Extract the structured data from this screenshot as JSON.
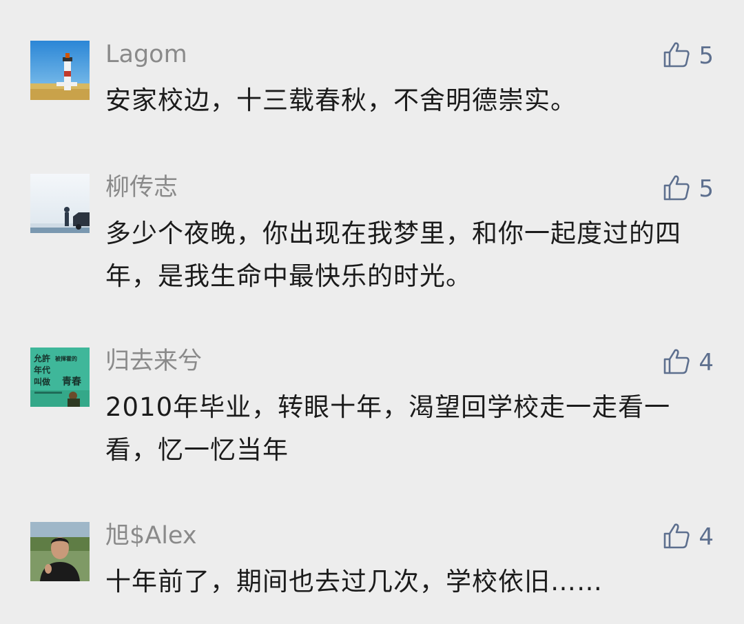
{
  "comments": [
    {
      "username": "Lagom",
      "like_count": "5",
      "text": "安家校边，十三载春秋，不舍明德崇实。",
      "avatar_subject": "lighthouse"
    },
    {
      "username": "柳传志",
      "like_count": "5",
      "text": "多少个夜晚，你出现在我梦里，和你一起度过的四年，是我生命中最快乐的时光。",
      "avatar_subject": "person-by-car-in-snow"
    },
    {
      "username": "归去来兮",
      "like_count": "4",
      "text": "2010年毕业，转眼十年，渴望回学校走一走看一看，忆一忆当年",
      "avatar_subject": "book-cover",
      "avatar_text": {
        "line1": "允許",
        "line1b": "被揮霍的",
        "line2": "年代",
        "line3": "叫做",
        "line3b": "青春"
      }
    },
    {
      "username": "旭$Alex",
      "like_count": "4",
      "text": "十年前了，期间也去过几次，学校依旧……",
      "avatar_subject": "man-portrait"
    }
  ],
  "colors": {
    "background": "#ededed",
    "username": "#8a8a8a",
    "like": "#5d6f8e",
    "text": "#1b1b1b"
  },
  "icons": {
    "like": "thumbs-up-icon"
  }
}
